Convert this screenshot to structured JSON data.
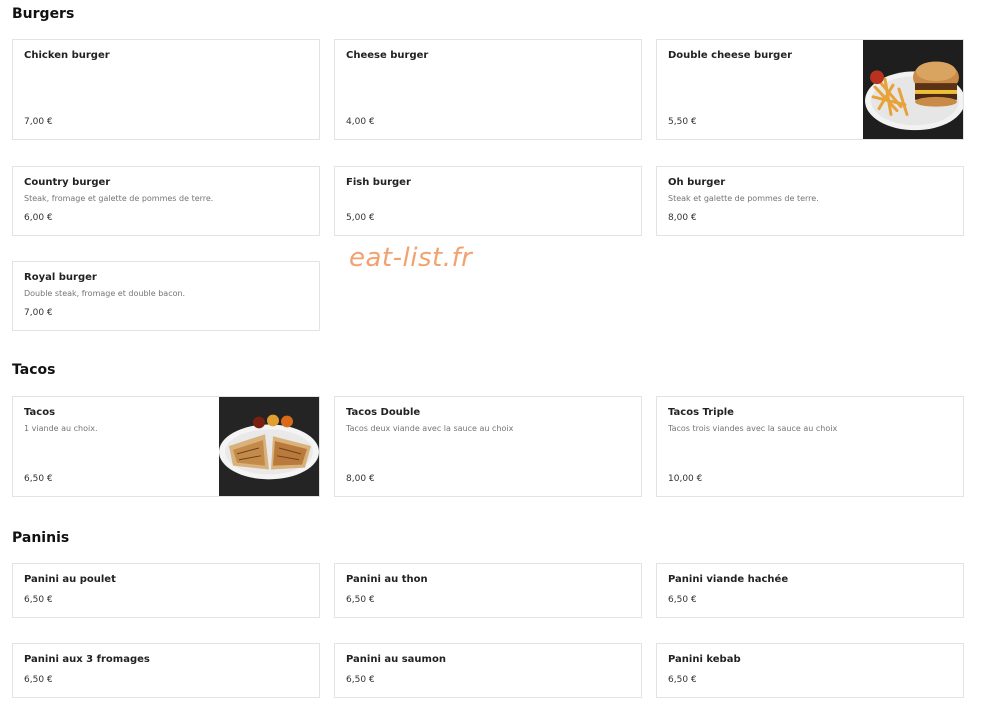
{
  "watermark": "eat-list.fr",
  "sections": {
    "burgers": {
      "title": "Burgers",
      "items": [
        {
          "name": "Chicken burger",
          "description": "",
          "price": "7,00 €"
        },
        {
          "name": "Cheese burger",
          "description": "",
          "price": "4,00 €"
        },
        {
          "name": "Double cheese burger",
          "description": "",
          "price": "5,50 €",
          "image": "burger-fries-photo"
        },
        {
          "name": "Country burger",
          "description": "Steak, fromage et galette de pommes de terre.",
          "price": "6,00 €"
        },
        {
          "name": "Fish burger",
          "description": "",
          "price": "5,00 €"
        },
        {
          "name": "Oh burger",
          "description": "Steak et galette de pommes de terre.",
          "price": "8,00 €"
        },
        {
          "name": "Royal burger",
          "description": "Double steak, fromage et double bacon.",
          "price": "7,00 €"
        }
      ]
    },
    "tacos": {
      "title": "Tacos",
      "items": [
        {
          "name": "Tacos",
          "description": "1 viande au choix.",
          "price": "6,50 €",
          "image": "tacos-sauces-photo"
        },
        {
          "name": "Tacos Double",
          "description": "Tacos deux viande avec la sauce au choix",
          "price": "8,00 €"
        },
        {
          "name": "Tacos Triple",
          "description": "Tacos trois viandes avec la sauce au choix",
          "price": "10,00 €"
        }
      ]
    },
    "paninis": {
      "title": "Paninis",
      "items": [
        {
          "name": "Panini au poulet",
          "price": "6,50 €"
        },
        {
          "name": "Panini au thon",
          "price": "6,50 €"
        },
        {
          "name": "Panini viande hachée",
          "price": "6,50 €"
        },
        {
          "name": "Panini aux 3 fromages",
          "price": "6,50 €"
        },
        {
          "name": "Panini au saumon",
          "price": "6,50 €"
        },
        {
          "name": "Panini kebab",
          "price": "6,50 €"
        }
      ]
    }
  }
}
